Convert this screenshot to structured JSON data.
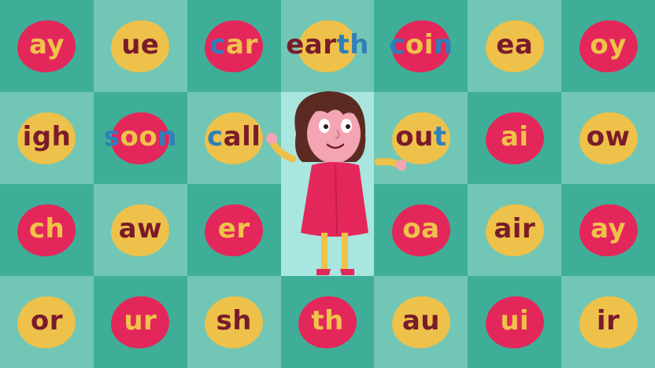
{
  "colors": {
    "teal_dark": "#3fae98",
    "teal_light": "#72c6b6",
    "spot": "#a9e6df",
    "pink": "#e4275a",
    "yellow": "#eec14a",
    "text_dark": "#7a1b2b",
    "text_yellow": "#efc24a",
    "text_blue": "#2f7fb9"
  },
  "tiles": [
    {
      "blob": "pink",
      "parts": [
        {
          "t": "ay",
          "c": "text_yellow"
        }
      ]
    },
    {
      "blob": "yellow",
      "parts": [
        {
          "t": "ue",
          "c": "text_dark"
        }
      ]
    },
    {
      "blob": "pink",
      "parts": [
        {
          "t": "c",
          "c": "text_blue"
        },
        {
          "t": "ar",
          "c": "text_yellow"
        }
      ]
    },
    {
      "blob": "yellow",
      "parts": [
        {
          "t": "ear",
          "c": "text_dark"
        },
        {
          "t": "th",
          "c": "text_blue"
        }
      ]
    },
    {
      "blob": "pink",
      "parts": [
        {
          "t": "c",
          "c": "text_blue"
        },
        {
          "t": "oi",
          "c": "text_yellow"
        },
        {
          "t": "n",
          "c": "text_blue"
        }
      ]
    },
    {
      "blob": "yellow",
      "parts": [
        {
          "t": "ea",
          "c": "text_dark"
        }
      ]
    },
    {
      "blob": "pink",
      "parts": [
        {
          "t": "oy",
          "c": "text_yellow"
        }
      ]
    },
    {
      "blob": "yellow",
      "parts": [
        {
          "t": "igh",
          "c": "text_dark"
        }
      ]
    },
    {
      "blob": "pink",
      "parts": [
        {
          "t": "s",
          "c": "text_blue"
        },
        {
          "t": "oo",
          "c": "text_yellow"
        },
        {
          "t": "n",
          "c": "text_blue"
        }
      ]
    },
    {
      "blob": "yellow",
      "parts": [
        {
          "t": "c",
          "c": "text_blue"
        },
        {
          "t": "all",
          "c": "text_dark"
        }
      ]
    },
    {
      "blob": "none",
      "parts": []
    },
    {
      "blob": "yellow",
      "parts": [
        {
          "t": "ou",
          "c": "text_dark"
        },
        {
          "t": "t",
          "c": "text_blue"
        }
      ]
    },
    {
      "blob": "pink",
      "parts": [
        {
          "t": "ai",
          "c": "text_yellow"
        }
      ]
    },
    {
      "blob": "yellow",
      "parts": [
        {
          "t": "ow",
          "c": "text_dark"
        }
      ]
    },
    {
      "blob": "pink",
      "parts": [
        {
          "t": "ch",
          "c": "text_yellow"
        }
      ]
    },
    {
      "blob": "yellow",
      "parts": [
        {
          "t": "aw",
          "c": "text_dark"
        }
      ]
    },
    {
      "blob": "pink",
      "parts": [
        {
          "t": "er",
          "c": "text_yellow"
        }
      ]
    },
    {
      "blob": "none",
      "parts": []
    },
    {
      "blob": "pink",
      "parts": [
        {
          "t": "oa",
          "c": "text_yellow"
        }
      ]
    },
    {
      "blob": "yellow",
      "parts": [
        {
          "t": "air",
          "c": "text_dark"
        }
      ]
    },
    {
      "blob": "pink",
      "parts": [
        {
          "t": "ay",
          "c": "text_yellow"
        }
      ]
    },
    {
      "blob": "yellow",
      "parts": [
        {
          "t": "or",
          "c": "text_dark"
        }
      ]
    },
    {
      "blob": "pink",
      "parts": [
        {
          "t": "ur",
          "c": "text_yellow"
        }
      ]
    },
    {
      "blob": "yellow",
      "parts": [
        {
          "t": "sh",
          "c": "text_dark"
        }
      ]
    },
    {
      "blob": "pink",
      "parts": [
        {
          "t": "th",
          "c": "text_yellow"
        }
      ]
    },
    {
      "blob": "yellow",
      "parts": [
        {
          "t": "au",
          "c": "text_dark"
        }
      ]
    },
    {
      "blob": "pink",
      "parts": [
        {
          "t": "ui",
          "c": "text_yellow"
        }
      ]
    },
    {
      "blob": "yellow",
      "parts": [
        {
          "t": "ir",
          "c": "text_dark"
        }
      ]
    }
  ],
  "character": {
    "icon": "cartoon-girl-icon"
  }
}
